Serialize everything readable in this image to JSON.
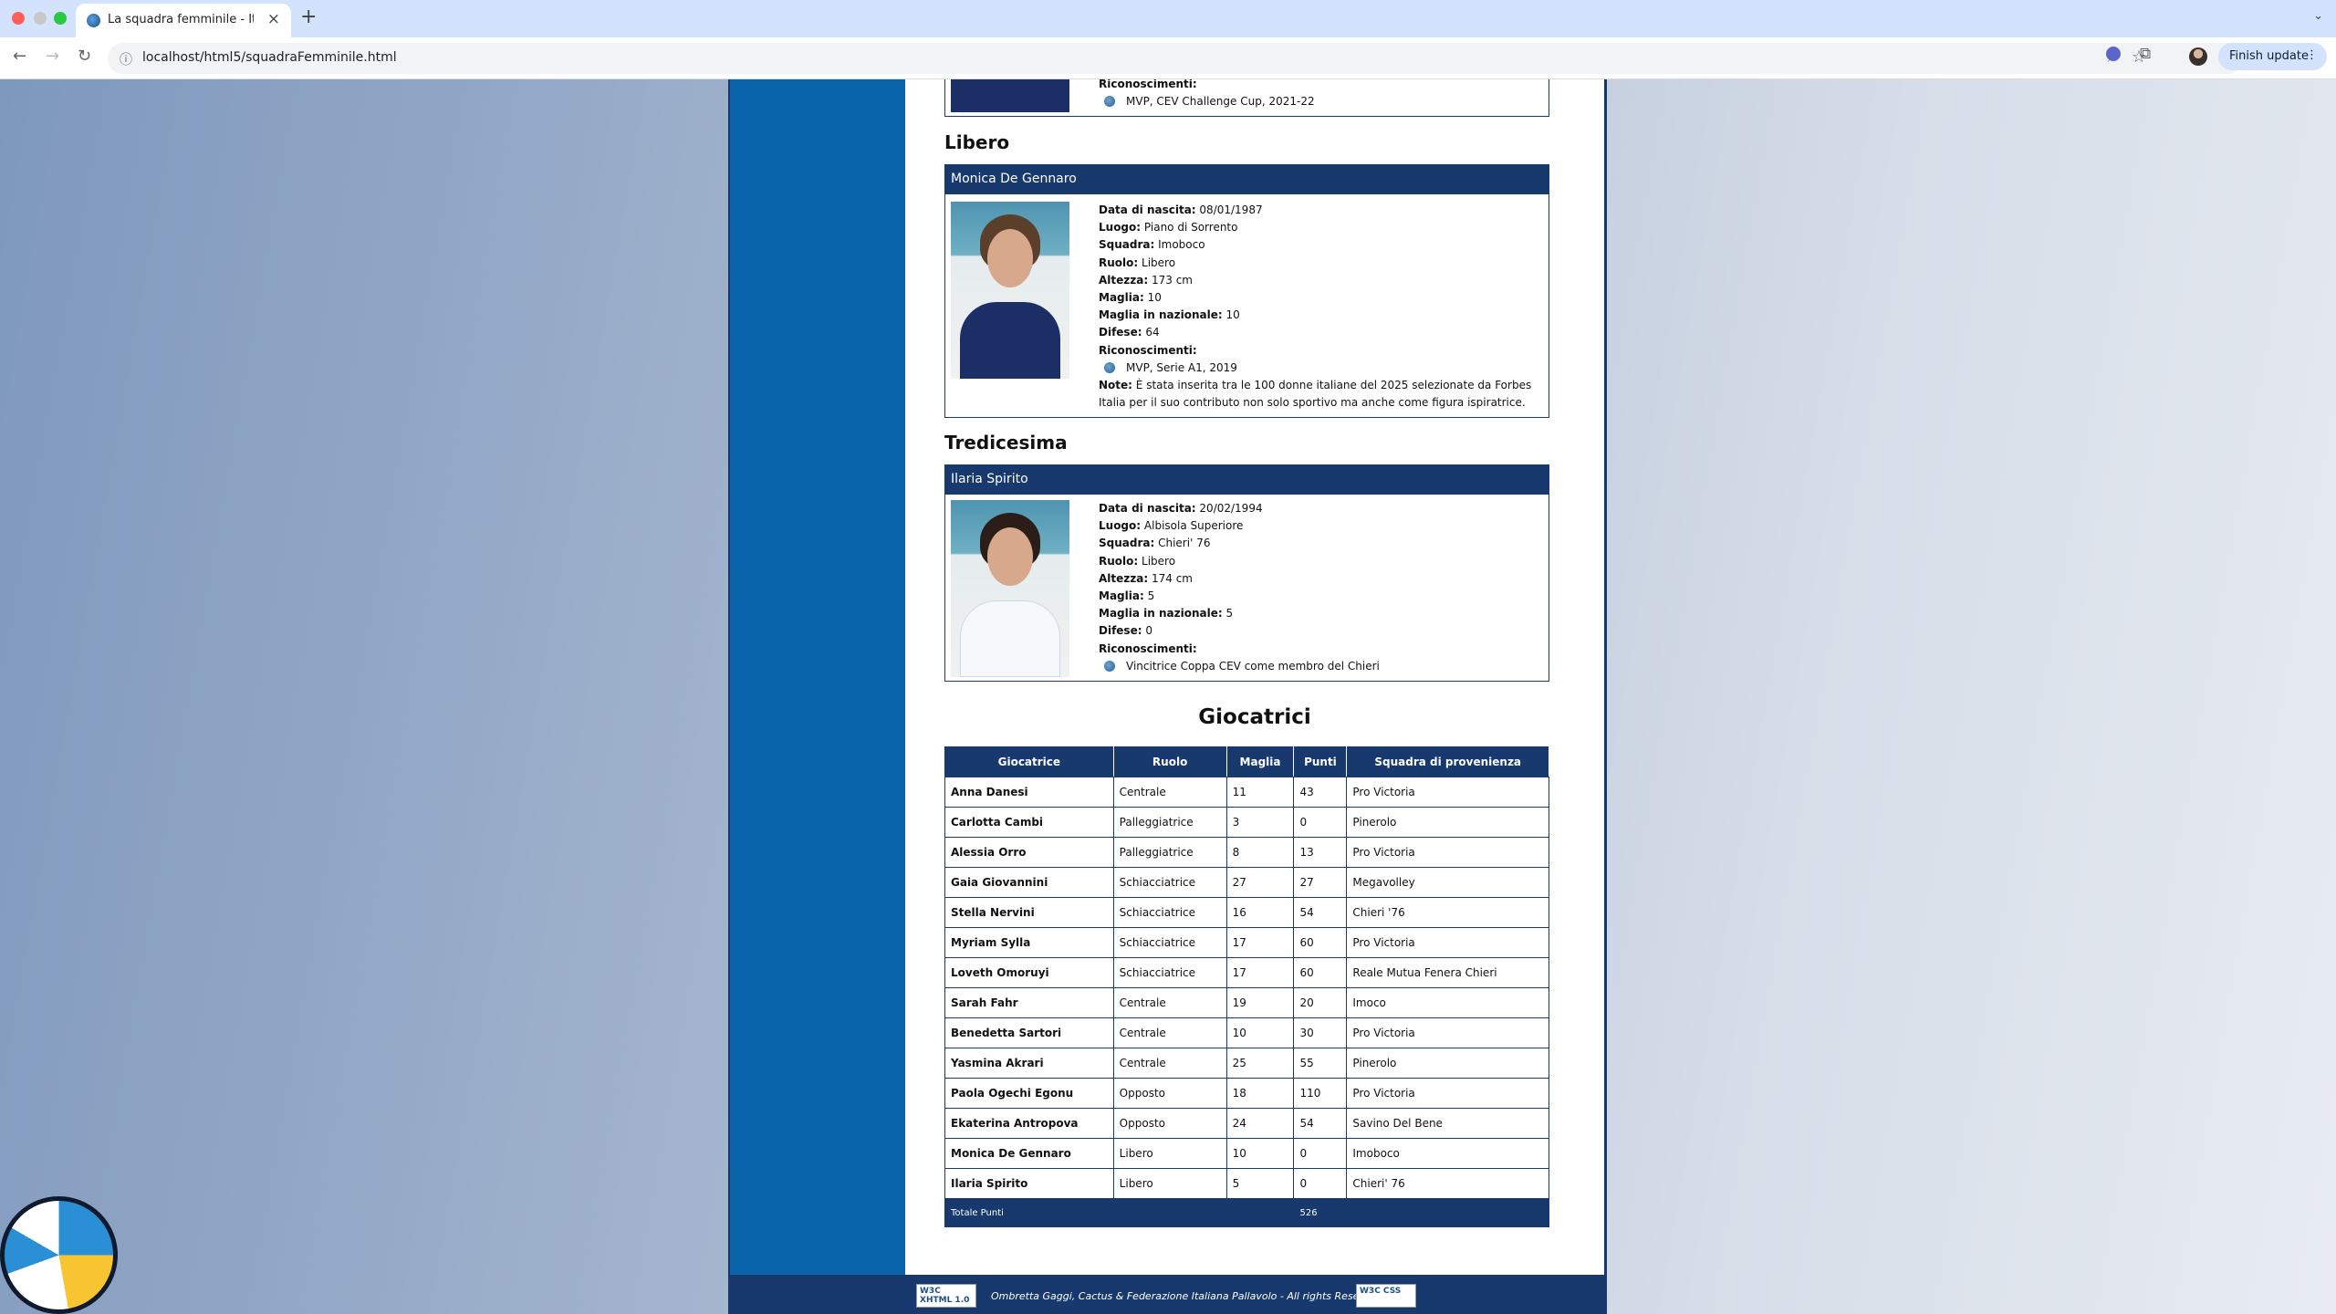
{
  "browser": {
    "tab_title": "La squadra femminile - Italvo",
    "url": "localhost/html5/squadraFemminile.html",
    "finish_update": "Finish update"
  },
  "players_top": {
    "prev_award_label": "Riconoscimenti:",
    "prev_award": "MVP, CEV Challenge Cup, 2021-22"
  },
  "sections": [
    {
      "heading": "Libero",
      "name": "Monica De Gennaro",
      "fields": [
        {
          "label": "Data di nascita:",
          "value": "08/01/1987"
        },
        {
          "label": "Luogo:",
          "value": "Piano di Sorrento"
        },
        {
          "label": "Squadra:",
          "value": "Imoboco"
        },
        {
          "label": "Ruolo:",
          "value": "Libero"
        },
        {
          "label": "Altezza:",
          "value": "173 cm"
        },
        {
          "label": "Maglia:",
          "value": "10"
        },
        {
          "label": "Maglia in nazionale:",
          "value": "10"
        },
        {
          "label": "Difese:",
          "value": "64"
        }
      ],
      "awards_label": "Riconoscimenti:",
      "award": "MVP, Serie A1, 2019",
      "note_label": "Note:",
      "note": "È stata inserita tra le 100 donne italiane del 2025 selezionate da Forbes Italia per il suo contributo non solo sportivo ma anche come figura ispiratrice."
    },
    {
      "heading": "Tredicesima",
      "name": "Ilaria Spirito",
      "fields": [
        {
          "label": "Data di nascita:",
          "value": "20/02/1994"
        },
        {
          "label": "Luogo:",
          "value": "Albisola Superiore"
        },
        {
          "label": "Squadra:",
          "value": "Chieri' 76"
        },
        {
          "label": "Ruolo:",
          "value": "Libero"
        },
        {
          "label": "Altezza:",
          "value": "174 cm"
        },
        {
          "label": "Maglia:",
          "value": "5"
        },
        {
          "label": "Maglia in nazionale:",
          "value": "5"
        },
        {
          "label": "Difese:",
          "value": "0"
        }
      ],
      "awards_label": "Riconoscimenti:",
      "award": "Vincitrice Coppa CEV come membro del Chieri"
    }
  ],
  "table": {
    "title": "Giocatrici",
    "headers": [
      "Giocatrice",
      "Ruolo",
      "Maglia",
      "Punti",
      "Squadra di provenienza"
    ],
    "rows": [
      [
        "Anna Danesi",
        "Centrale",
        "11",
        "43",
        "Pro Victoria"
      ],
      [
        "Carlotta Cambi",
        "Palleggiatrice",
        "3",
        "0",
        "Pinerolo"
      ],
      [
        "Alessia Orro",
        "Palleggiatrice",
        "8",
        "13",
        "Pro Victoria"
      ],
      [
        "Gaia Giovannini",
        "Schiacciatrice",
        "27",
        "27",
        "Megavolley"
      ],
      [
        "Stella Nervini",
        "Schiacciatrice",
        "16",
        "54",
        "Chieri '76"
      ],
      [
        "Myriam Sylla",
        "Schiacciatrice",
        "17",
        "60",
        "Pro Victoria"
      ],
      [
        "Loveth Omoruyi",
        "Schiacciatrice",
        "17",
        "60",
        "Reale Mutua Fenera Chieri"
      ],
      [
        "Sarah Fahr",
        "Centrale",
        "19",
        "20",
        "Imoco"
      ],
      [
        "Benedetta Sartori",
        "Centrale",
        "10",
        "30",
        "Pro Victoria"
      ],
      [
        "Yasmina Akrari",
        "Centrale",
        "25",
        "55",
        "Pinerolo"
      ],
      [
        "Paola Ogechi Egonu",
        "Opposto",
        "18",
        "110",
        "Pro Victoria"
      ],
      [
        "Ekaterina Antropova",
        "Opposto",
        "24",
        "54",
        "Savino Del Bene"
      ],
      [
        "Monica De Gennaro",
        "Libero",
        "10",
        "0",
        "Imoboco"
      ],
      [
        "Ilaria Spirito",
        "Libero",
        "5",
        "0",
        "Chieri' 76"
      ]
    ],
    "total_label": "Totale Punti",
    "total_value": "526"
  },
  "footer": {
    "text": "Ombretta Gaggi, Cactus & Federazione Italiana Pallavolo - All rights Reserved",
    "badge_xhtml": "W3C XHTML 1.0",
    "badge_css": "W3C CSS"
  }
}
